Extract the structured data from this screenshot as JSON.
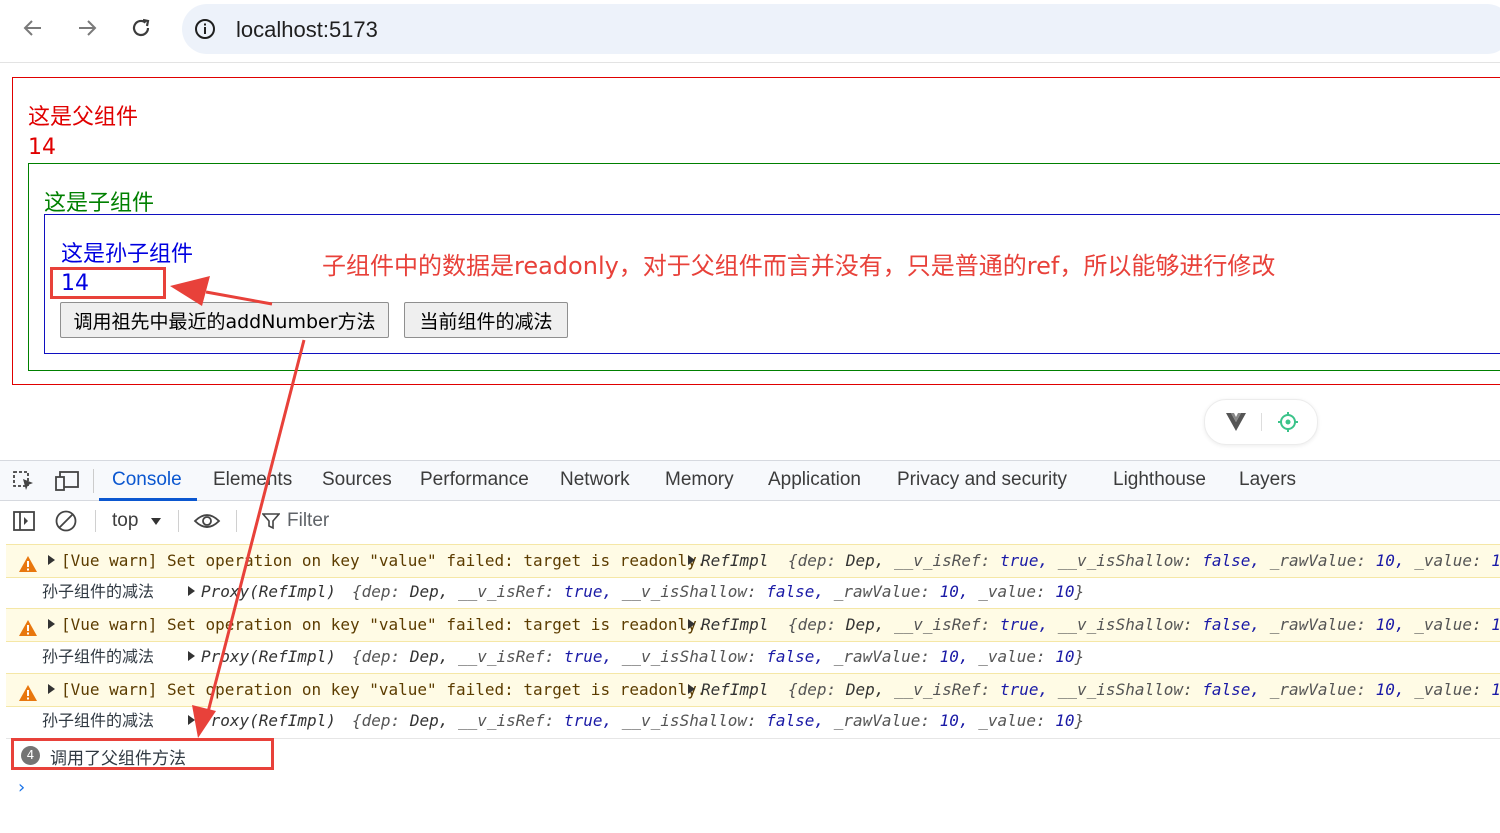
{
  "browser": {
    "url": "localhost:5173",
    "icons": [
      "back-arrow-icon",
      "forward-arrow-icon",
      "reload-icon",
      "site-info-icon"
    ]
  },
  "page": {
    "parent_title": "这是父组件",
    "parent_value": "14",
    "child_title": "这是子组件",
    "grandchild_title": "这是孙子组件",
    "grandchild_value": "14",
    "btn_call_ancestor": "调用祖先中最近的addNumber方法",
    "btn_subtract": "当前组件的减法",
    "annotation": "子组件中的数据是readonly，对于父组件而言并没有，只是普通的ref，所以能够进行修改",
    "colors": {
      "parent": "#e00000",
      "child": "#008000",
      "grandchild": "#0000e0",
      "annotation": "#e8413a"
    }
  },
  "devtools": {
    "tabs": [
      "Console",
      "Elements",
      "Sources",
      "Performance",
      "Network",
      "Memory",
      "Application",
      "Privacy and security",
      "Lighthouse",
      "Layers"
    ],
    "active_tab": "Console",
    "context": "top",
    "filter_placeholder": "Filter",
    "console": {
      "warn_message": "[Vue warn] Set operation on key \"value\" failed: target is readonly.",
      "warn_obj_type": "RefImpl",
      "log_label": "孙子组件的减法",
      "log_obj_type": "Proxy(RefImpl)",
      "obj": {
        "open": "{",
        "dep_key": "dep:",
        "dep_val": "Dep,",
        "isref_key": "__v_isRef:",
        "isref_val": "true,",
        "shallow_key": "__v_isShallow:",
        "shallow_val": "false,",
        "raw_key": "_rawValue:",
        "raw_val": "10,",
        "value_key": "_value:",
        "value_val": "10",
        "close": "}"
      },
      "group_count": "4",
      "group_message": "调用了父组件方法",
      "prompt": "›"
    }
  }
}
